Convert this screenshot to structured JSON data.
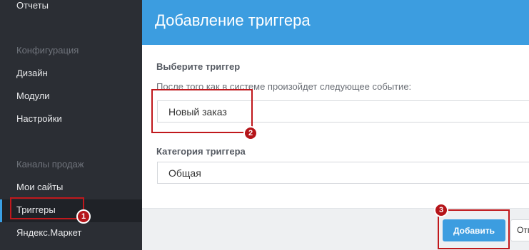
{
  "sidebar": {
    "reports": "Отчеты",
    "config_section": "Конфигурация",
    "design": "Дизайн",
    "modules": "Модули",
    "settings": "Настройки",
    "channels_section": "Каналы продаж",
    "my_sites": "Мои сайты",
    "triggers": "Триггеры",
    "yandex_market": "Яндекс.Маркет"
  },
  "modal": {
    "title": "Добавление триггера",
    "trigger_label": "Выберите триггер",
    "trigger_hint": "После того как в системе произойдет следующее событие:",
    "trigger_value": "Новый заказ",
    "category_label": "Категория триггера",
    "category_value": "Общая",
    "add_button": "Добавить",
    "cancel_button": "Отмена"
  },
  "annotations": {
    "badge1": "1",
    "badge2": "2",
    "badge3": "3"
  },
  "colors": {
    "accent": "#3c9de0",
    "highlight": "#c0181c",
    "sidebar_bg": "#2b2e34"
  }
}
